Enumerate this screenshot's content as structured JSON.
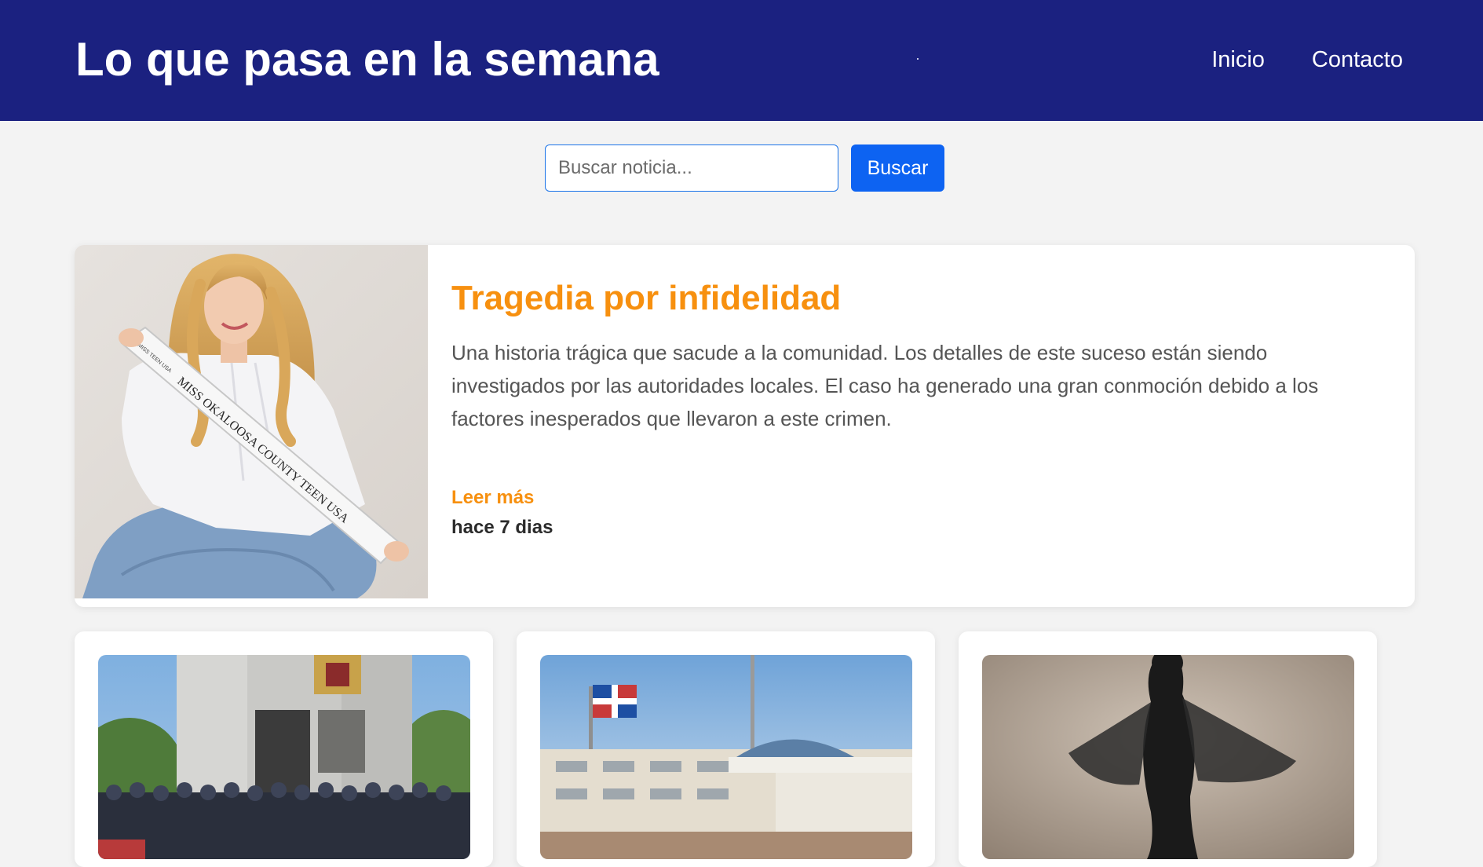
{
  "header": {
    "title": "Lo que pasa en la semana",
    "nav": [
      {
        "label": "Inicio"
      },
      {
        "label": "Contacto"
      }
    ]
  },
  "search": {
    "placeholder": "Buscar noticia...",
    "value": "",
    "button_label": "Buscar"
  },
  "featured": {
    "title": "Tragedia por infidelidad",
    "summary": "Una historia trágica que sacude a la comunidad. Los detalles de este suceso están siendo investigados por las autoridades locales. El caso ha generado una gran conmoción debido a los factores inesperados que llevaron a este crimen.",
    "read_more": "Leer más",
    "time_ago": "hace 7 dias",
    "image": {
      "sash_text": "MISS OKALOOSA COUNTY TEEN USA",
      "sash_badge": "MISS TEEN USA"
    }
  },
  "cards": [
    {
      "image": "government-building-group-photo"
    },
    {
      "image": "building-with-dominican-flag"
    },
    {
      "image": "woman-in-black-dress"
    }
  ],
  "colors": {
    "header_bg": "#1b2180",
    "accent": "#f7900f",
    "button": "#0d63f2",
    "page_bg": "#f3f3f3"
  }
}
